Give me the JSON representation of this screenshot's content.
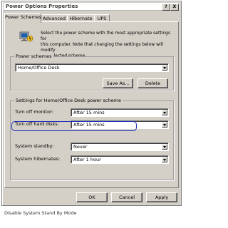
{
  "window": {
    "title": "Power Options Properties",
    "help_button": "?",
    "close_button": "X"
  },
  "tabs": [
    {
      "label": "Power Schemes",
      "active": true
    },
    {
      "label": "Advanced",
      "active": false
    },
    {
      "label": "Hibernate",
      "active": false
    },
    {
      "label": "UPS",
      "active": false
    }
  ],
  "description": {
    "line1": "Select the power scheme with the most appropriate settings for",
    "line2": "this computer. Note that changing the settings below will modify",
    "line3": "the selected scheme."
  },
  "power_schemes": {
    "legend": "Power schemes",
    "selected": "Home/Office Desk",
    "save_as_label": "Save As...",
    "delete_label": "Delete"
  },
  "settings": {
    "legend": "Settings for Home/Office Desk power scheme",
    "rows": [
      {
        "label": "Turn off monitor:",
        "value": "After 15 mins"
      },
      {
        "label": "Turn off hard disks:",
        "value": "After 15 mins"
      },
      {
        "label": "System standby:",
        "value": "Never"
      },
      {
        "label": "System hibernates:",
        "value": "After 1 hour"
      }
    ]
  },
  "buttons": {
    "ok": "OK",
    "cancel": "Cancel",
    "apply": "Apply"
  },
  "caption": "Disable System Stand By Mode",
  "colors": {
    "dialog_bg": "#d4d0c8",
    "highlight": "#1e2fb8"
  }
}
